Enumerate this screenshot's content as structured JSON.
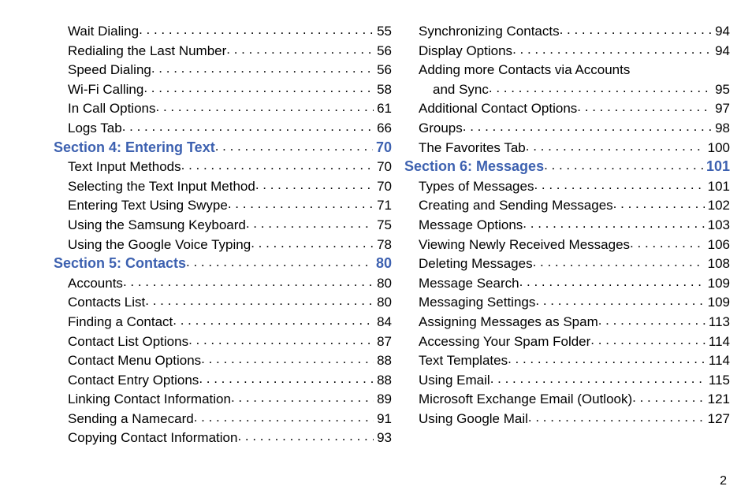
{
  "columns": {
    "left": [
      {
        "type": "item",
        "label": "Wait Dialing",
        "page": "55"
      },
      {
        "type": "item",
        "label": "Redialing the Last Number",
        "page": "56"
      },
      {
        "type": "item",
        "label": "Speed Dialing",
        "page": "56"
      },
      {
        "type": "item",
        "label": "Wi-Fi Calling",
        "page": "58"
      },
      {
        "type": "item",
        "label": "In Call Options",
        "page": "61"
      },
      {
        "type": "item",
        "label": "Logs Tab",
        "page": "66"
      },
      {
        "type": "section",
        "label": "Section 4:  Entering Text",
        "page": "70"
      },
      {
        "type": "item",
        "label": "Text Input Methods",
        "page": "70"
      },
      {
        "type": "item",
        "label": "Selecting the Text Input Method",
        "page": "70"
      },
      {
        "type": "item",
        "label": "Entering Text Using Swype",
        "page": "71"
      },
      {
        "type": "item",
        "label": "Using the Samsung Keyboard",
        "page": "75"
      },
      {
        "type": "item",
        "label": "Using the Google Voice Typing",
        "page": "78"
      },
      {
        "type": "section",
        "label": "Section 5:  Contacts",
        "page": "80"
      },
      {
        "type": "item",
        "label": "Accounts",
        "page": "80"
      },
      {
        "type": "item",
        "label": "Contacts List",
        "page": "80"
      },
      {
        "type": "item",
        "label": "Finding a Contact",
        "page": "84"
      },
      {
        "type": "item",
        "label": "Contact List Options",
        "page": "87"
      },
      {
        "type": "item",
        "label": "Contact Menu Options",
        "page": "88"
      },
      {
        "type": "item",
        "label": "Contact Entry Options",
        "page": "88"
      },
      {
        "type": "item",
        "label": "Linking Contact Information",
        "page": "89"
      },
      {
        "type": "item",
        "label": "Sending a Namecard",
        "page": "91"
      },
      {
        "type": "item",
        "label": "Copying Contact Information",
        "page": "93"
      }
    ],
    "right": [
      {
        "type": "item",
        "label": "Synchronizing Contacts",
        "page": "94"
      },
      {
        "type": "item",
        "label": "Display Options",
        "page": "94"
      },
      {
        "type": "item-noline",
        "label": "Adding more Contacts via Accounts",
        "page": ""
      },
      {
        "type": "continuation",
        "label": "and Sync",
        "page": "95"
      },
      {
        "type": "item",
        "label": "Additional Contact Options",
        "page": "97"
      },
      {
        "type": "item",
        "label": "Groups",
        "page": "98"
      },
      {
        "type": "item",
        "label": "The Favorites Tab",
        "page": "100"
      },
      {
        "type": "section",
        "label": "Section 6:  Messages",
        "page": "101"
      },
      {
        "type": "item",
        "label": "Types of Messages",
        "page": "101"
      },
      {
        "type": "item",
        "label": "Creating and Sending Messages",
        "page": "102"
      },
      {
        "type": "item",
        "label": "Message Options",
        "page": "103"
      },
      {
        "type": "item",
        "label": "Viewing Newly Received Messages",
        "page": "106"
      },
      {
        "type": "item",
        "label": "Deleting Messages",
        "page": "108"
      },
      {
        "type": "item",
        "label": "Message Search",
        "page": "109"
      },
      {
        "type": "item",
        "label": "Messaging Settings",
        "page": "109"
      },
      {
        "type": "item",
        "label": "Assigning Messages as Spam",
        "page": "113"
      },
      {
        "type": "item",
        "label": "Accessing Your Spam Folder",
        "page": "114"
      },
      {
        "type": "item",
        "label": "Text Templates",
        "page": "114"
      },
      {
        "type": "item",
        "label": "Using Email",
        "page": "115"
      },
      {
        "type": "item",
        "label": "Microsoft Exchange Email (Outlook)",
        "page": "121"
      },
      {
        "type": "item",
        "label": "Using Google Mail",
        "page": "127"
      }
    ]
  },
  "footer": {
    "page_number": "2"
  }
}
